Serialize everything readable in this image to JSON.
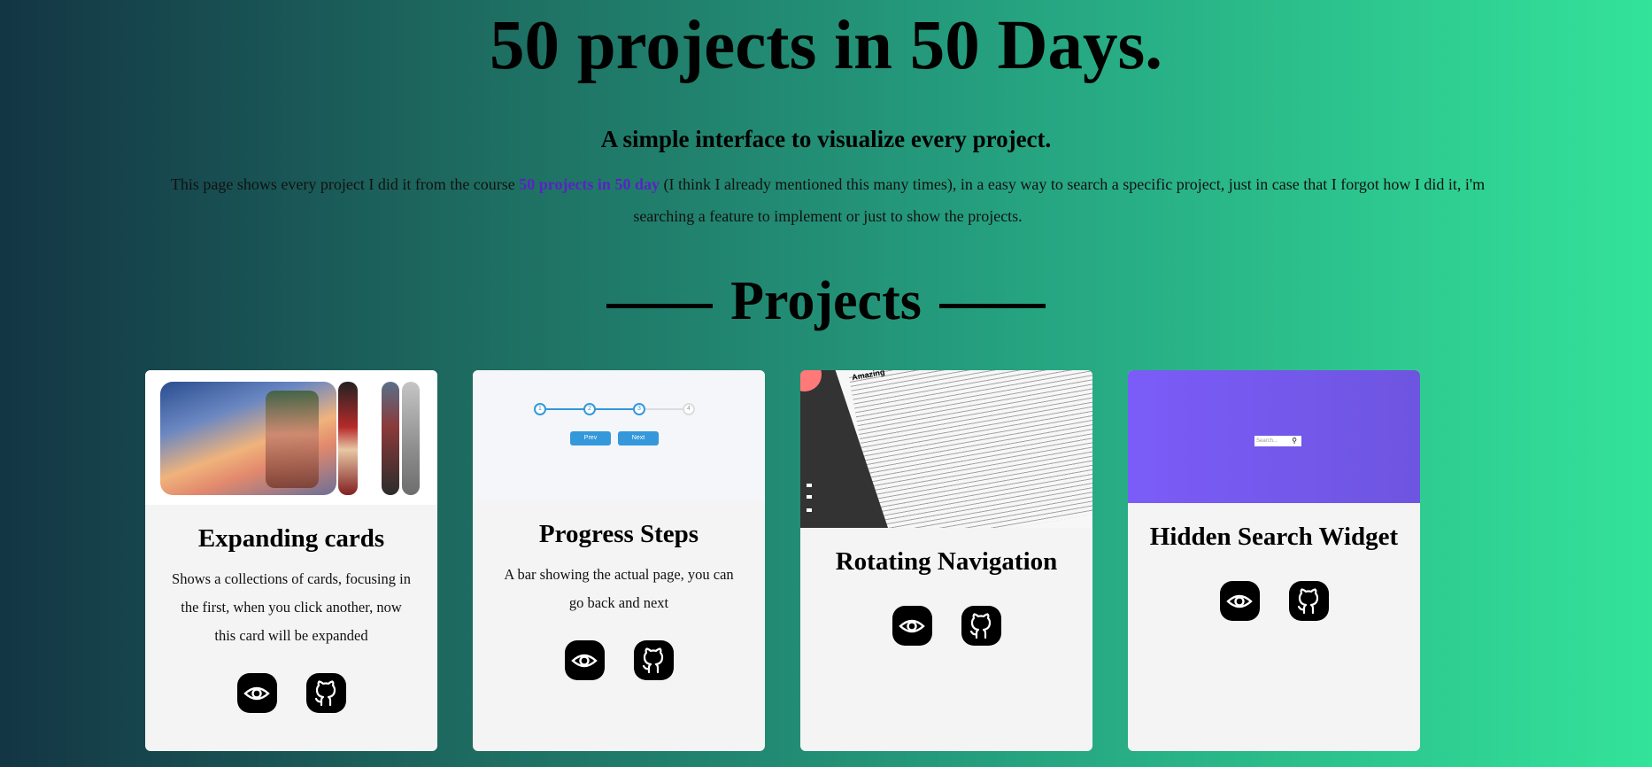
{
  "header": {
    "title": "50 projects in 50 Days.",
    "subtitle": "A simple interface to visualize every project.",
    "intro_before": "This page shows every project I did it from the course ",
    "intro_link": "50 projects in 50 day",
    "intro_after": " (I think I already mentioned this many times), in a easy way to search a specific project, just in case that I forgot how I did it, i'm searching a feature to implement or just to show the projects."
  },
  "section": {
    "title": "Projects"
  },
  "projects": [
    {
      "title": "Expanding cards",
      "description": "Shows a collections of cards, focusing in the first, when you click another, now this card will be expanded",
      "view_icon": "eye-icon",
      "repo_icon": "github-icon"
    },
    {
      "title": "Progress Steps",
      "description": "A bar showing the actual page, you can go back and next",
      "preview": {
        "steps": [
          "1",
          "2",
          "3",
          "4"
        ],
        "prev_label": "Prev",
        "next_label": "Next"
      },
      "view_icon": "eye-icon",
      "repo_icon": "github-icon"
    },
    {
      "title": "Rotating Navigation",
      "preview": {
        "heading": "Amazing"
      },
      "view_icon": "eye-icon",
      "repo_icon": "github-icon"
    },
    {
      "title": "Hidden Search Widget",
      "preview": {
        "placeholder": "Search..."
      },
      "view_icon": "eye-icon",
      "repo_icon": "github-icon"
    }
  ],
  "colors": {
    "gradient_start": "#133544",
    "gradient_end": "#33e39a",
    "link": "#5a22c6",
    "card_bg": "#f4f4f4"
  }
}
